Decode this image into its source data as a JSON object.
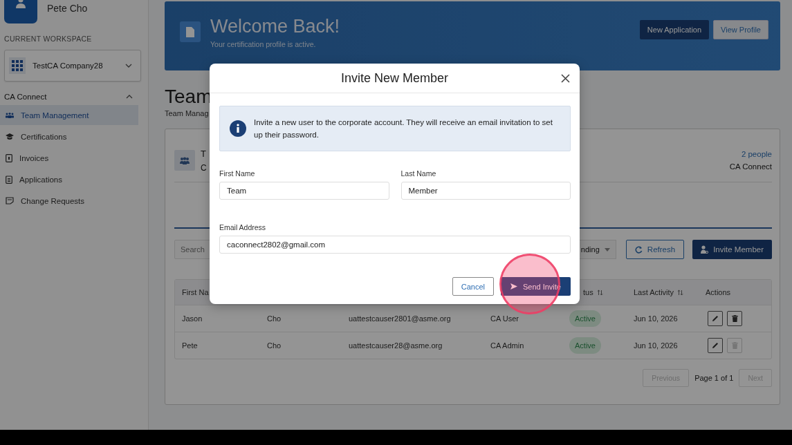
{
  "user": {
    "name": "Pete Cho"
  },
  "workspace": {
    "label": "CURRENT WORKSPACE",
    "value": "TestCA Company28"
  },
  "nav": {
    "section": "CA Connect",
    "expanded": true,
    "items": [
      {
        "label": "Team Management",
        "selected": true,
        "kind": "team"
      },
      {
        "label": "Certifications",
        "selected": false,
        "kind": "cap"
      },
      {
        "label": "Invoices",
        "selected": false,
        "kind": "invoice"
      },
      {
        "label": "Applications",
        "selected": false,
        "kind": "clipboard"
      },
      {
        "label": "Change Requests",
        "selected": false,
        "kind": "edit"
      }
    ]
  },
  "banner": {
    "title": "Welcome Back!",
    "subtitle": "Your certification profile is active.",
    "buttons": [
      {
        "label": "New Application",
        "kind": "primary"
      },
      {
        "label": "View Profile",
        "kind": "secondary"
      }
    ]
  },
  "page": {
    "heading": "Team",
    "breadcrumb": "Team Manag"
  },
  "card": {
    "title": "T",
    "subtitle": "C",
    "count": "2 people",
    "org": "CA Connect"
  },
  "toolbar": {
    "search_placeholder": "Search",
    "filter_value": "nding",
    "buttons": [
      {
        "label": "Refresh",
        "kind": "outline"
      },
      {
        "label": "Invite Member",
        "kind": "primary"
      }
    ]
  },
  "table": {
    "columns": [
      {
        "label": "First Na",
        "sortable": false
      },
      {
        "label": "tus",
        "sortable": true
      },
      {
        "label": "Last Activity",
        "sortable": true
      },
      {
        "label": "Actions",
        "sortable": false
      }
    ],
    "rows": [
      {
        "first": "Jason",
        "last": "Cho",
        "email": "uattestcauser2801@asme.org",
        "role": "CA User",
        "status": "Active",
        "last_activity": "Jun 10, 2026",
        "delete_disabled": false
      },
      {
        "first": "Pete",
        "last": "Cho",
        "email": "uattestcauser28@asme.org",
        "role": "CA Admin",
        "status": "Active",
        "last_activity": "Jun 10, 2026",
        "delete_disabled": true
      }
    ]
  },
  "pagination": {
    "previous": "Previous",
    "page": "Page 1 of 1",
    "next": "Next",
    "previous_disabled": true,
    "next_disabled": true
  },
  "modal": {
    "title": "Invite New Member",
    "info": "Invite a new user to the corporate account. They will receive an email invitation to set up their password.",
    "fields": [
      {
        "label": "First Name",
        "value": "Team"
      },
      {
        "label": "Last Name",
        "value": "Member"
      },
      {
        "label": "Email Address",
        "value": "caconnect2802@gmail.com"
      }
    ],
    "buttons": [
      {
        "label": "Cancel",
        "kind": "outline"
      },
      {
        "label": "Send Invite",
        "kind": "primary"
      }
    ]
  }
}
